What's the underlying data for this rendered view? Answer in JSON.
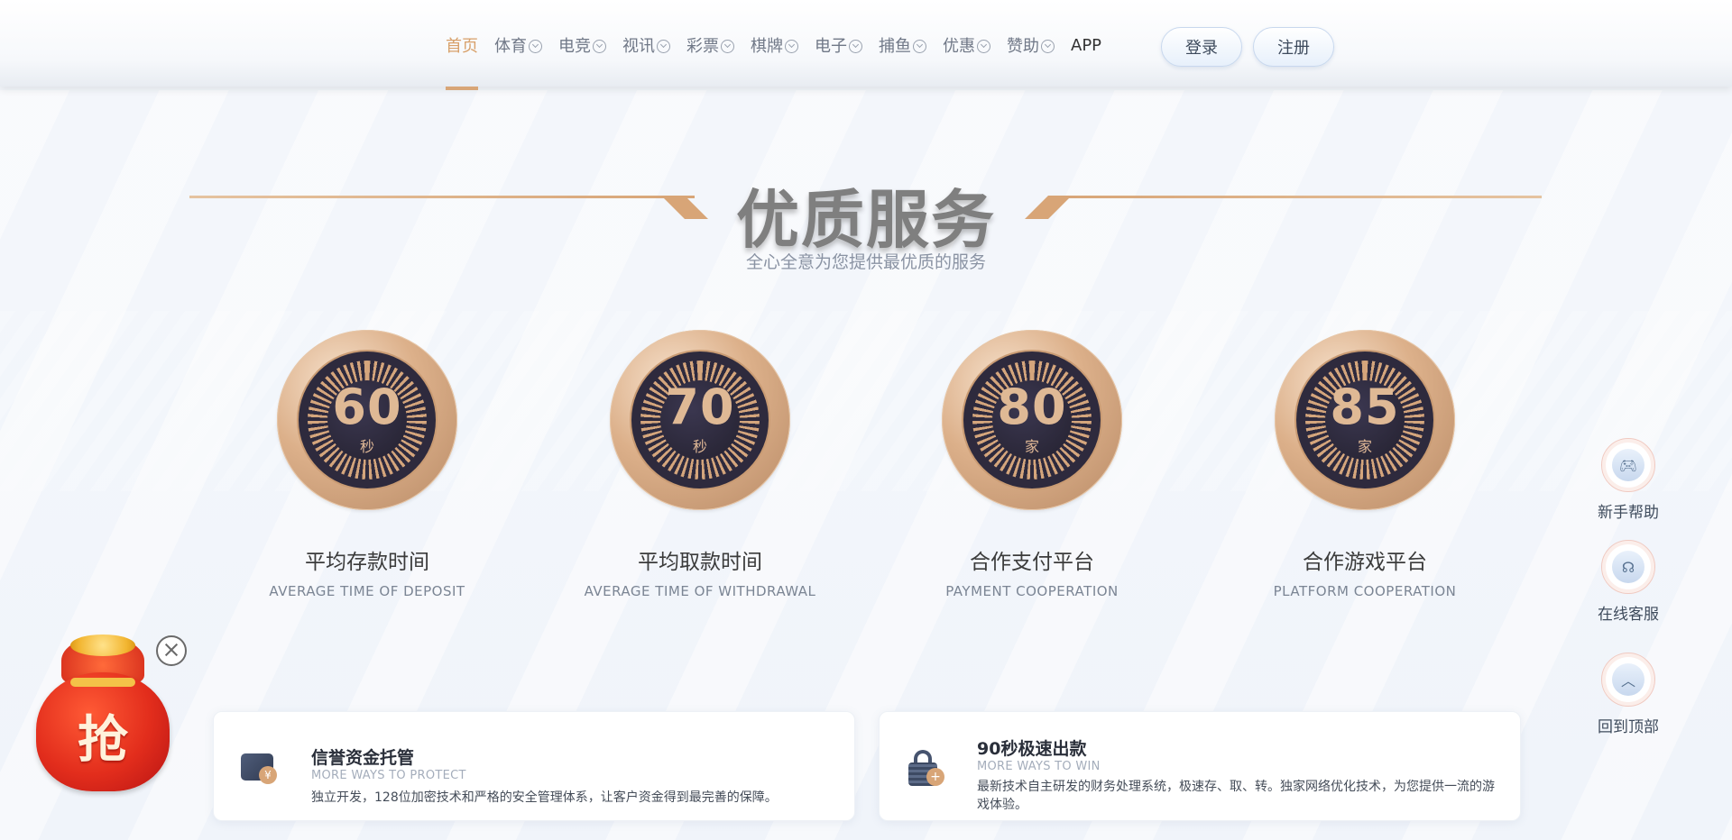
{
  "nav": {
    "items": [
      {
        "label": "首页",
        "active": true,
        "dropdown": false
      },
      {
        "label": "体育",
        "active": false,
        "dropdown": true
      },
      {
        "label": "电竞",
        "active": false,
        "dropdown": true
      },
      {
        "label": "视讯",
        "active": false,
        "dropdown": true
      },
      {
        "label": "彩票",
        "active": false,
        "dropdown": true
      },
      {
        "label": "棋牌",
        "active": false,
        "dropdown": true
      },
      {
        "label": "电子",
        "active": false,
        "dropdown": true
      },
      {
        "label": "捕鱼",
        "active": false,
        "dropdown": true
      },
      {
        "label": "优惠",
        "active": false,
        "dropdown": true
      },
      {
        "label": "赞助",
        "active": false,
        "dropdown": true
      },
      {
        "label": "APP",
        "active": false,
        "dropdown": false
      }
    ],
    "login_label": "登录",
    "register_label": "注册"
  },
  "section": {
    "title": "优质服务",
    "subtitle": "全心全意为您提供最优质的服务"
  },
  "stats": [
    {
      "value": "60",
      "unit": "秒",
      "title": "平均存款时间",
      "subtitle": "AVERAGE TIME OF DEPOSIT"
    },
    {
      "value": "70",
      "unit": "秒",
      "title": "平均取款时间",
      "subtitle": "AVERAGE TIME OF WITHDRAWAL"
    },
    {
      "value": "80",
      "unit": "家",
      "title": "合作支付平台",
      "subtitle": "PAYMENT COOPERATION"
    },
    {
      "value": "85",
      "unit": "家",
      "title": "合作游戏平台",
      "subtitle": "PLATFORM COOPERATION"
    }
  ],
  "side_float": {
    "help_label": "新手帮助",
    "service_label": "在线客服",
    "top_label": "回到顶部"
  },
  "red_bag": {
    "char": "抢"
  },
  "cards": [
    {
      "title": "信誉资金托管",
      "subtitle": "MORE WAYS TO PROTECT",
      "desc": "独立开发，128位加密技术和严格的安全管理体系，让客户资金得到最完善的保障。",
      "badge": "¥"
    },
    {
      "title": "90秒极速出款",
      "subtitle": "MORE WAYS TO WIN",
      "desc": "最新技术自主研发的财务处理系统，极速存、取、转。独家网络优化技术，为您提供一流的游戏体验。",
      "badge": "+"
    }
  ],
  "colors": {
    "accent": "#d8a577",
    "nav_text": "#707887",
    "medal_dark": "#2e2a3d"
  }
}
